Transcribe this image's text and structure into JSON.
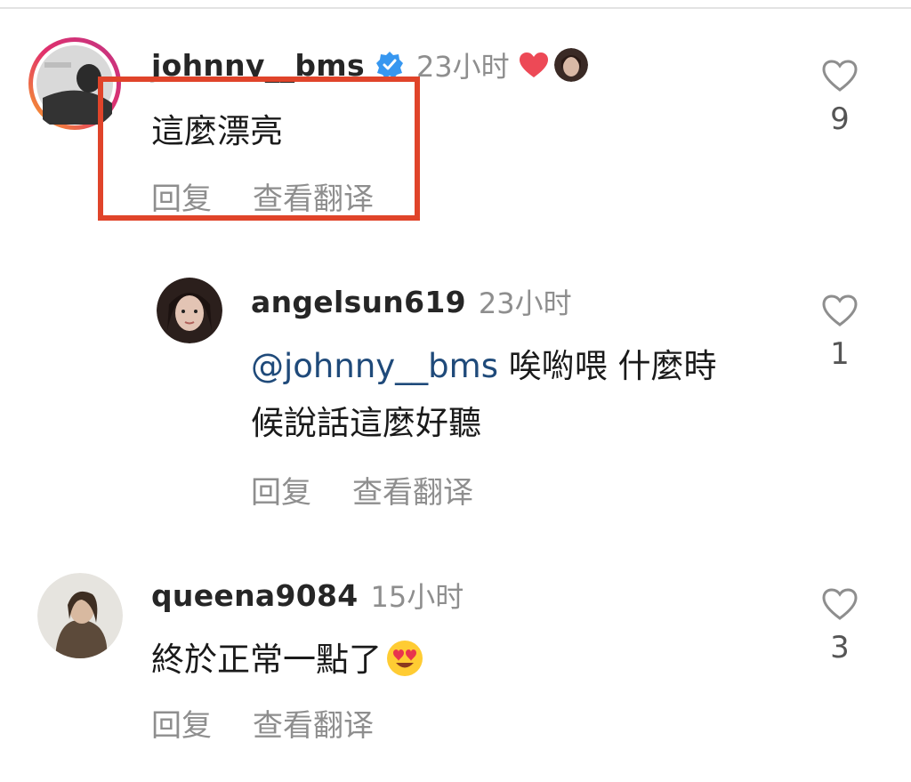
{
  "comments": [
    {
      "username": "johnny__bms",
      "verified": true,
      "time": "23小时",
      "liked_by_author": true,
      "text": "這麼漂亮",
      "actions": {
        "reply": "回复",
        "translate": "查看翻译"
      },
      "likes": "9"
    },
    {
      "username": "angelsun619",
      "time": "23小时",
      "mention": "@johnny__bms",
      "text_line1": " 唉喲喂 什麼時",
      "text_line2": "候說話這麼好聽",
      "actions": {
        "reply": "回复",
        "translate": "查看翻译"
      },
      "likes": "1"
    },
    {
      "username": "queena9084",
      "time": "15小时",
      "text": "終於正常一點了",
      "emoji": "heart-eyes",
      "actions": {
        "reply": "回复",
        "translate": "查看翻译"
      },
      "likes": "3"
    }
  ],
  "colors": {
    "highlight": "#e0442a",
    "verified_badge": "#3797f0",
    "liked_heart": "#ed4956",
    "mention": "#1f4a7a",
    "secondary_text": "#8e8e8e"
  }
}
